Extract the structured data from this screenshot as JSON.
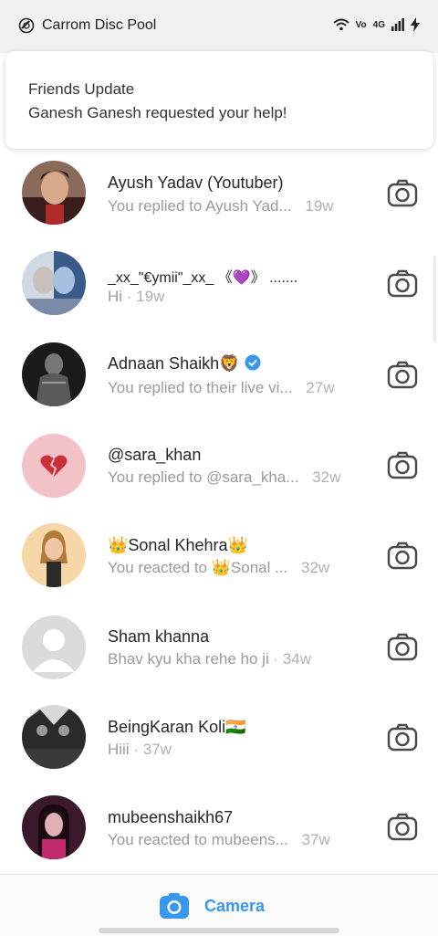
{
  "status_bar": {
    "app_name": "Carrom Disc Pool",
    "network": "4G"
  },
  "notification": {
    "title": "Friends Update",
    "body": "Ganesh Ganesh requested your help!"
  },
  "conversations": [
    {
      "name": "Ayush Yadav (Youtuber)",
      "preview": "You replied to Ayush Yad...",
      "time": "19w",
      "avatar": "photo-man"
    },
    {
      "name": "_xx_\"€ymii\"_xx_ 《💜》 .......",
      "preview": "Hi",
      "time": "19w",
      "avatar": "photo-couple"
    },
    {
      "name": "Adnaan Shaikh🦁",
      "preview": "You replied to their live vi...",
      "time": "27w",
      "avatar": "photo-dark",
      "verified": true
    },
    {
      "name": "@sara_khan",
      "preview": "You replied to @sara_kha...",
      "time": "32w",
      "avatar": "broken-heart"
    },
    {
      "name": "👑Sonal Khehra👑",
      "preview": "You reacted to 👑Sonal ...",
      "time": "32w",
      "avatar": "cartoon-girl"
    },
    {
      "name": "Sham khanna",
      "preview": "Bhav kyu kha rehe ho ji",
      "time": "34w",
      "avatar": "default-person"
    },
    {
      "name": "BeingKaran Koli🇮🇳",
      "preview": "Hiii",
      "time": "37w",
      "avatar": "photo-group"
    },
    {
      "name": "mubeenshaikh67",
      "preview": "You reacted to mubeens...",
      "time": "37w",
      "avatar": "photo-woman"
    }
  ],
  "separator": " · ",
  "bottom_bar": {
    "label": "Camera",
    "accent": "#3897f0"
  },
  "colors": {
    "secondary_text": "#9a9a9a",
    "verified": "#3897f0"
  }
}
